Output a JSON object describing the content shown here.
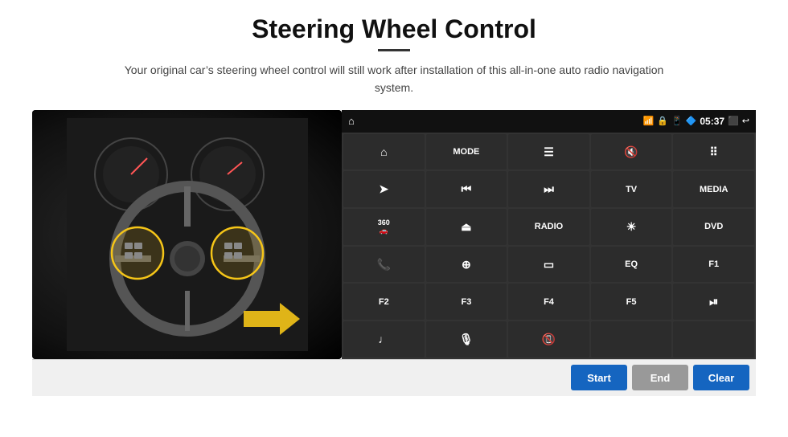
{
  "page": {
    "title": "Steering Wheel Control",
    "subtitle": "Your original car’s steering wheel control will still work after installation of this all-in-one auto radio navigation system.",
    "divider_color": "#333"
  },
  "status_bar": {
    "time": "05:37",
    "icons": [
      "wifi",
      "lock",
      "sim",
      "bluetooth",
      "cast",
      "back"
    ]
  },
  "grid_buttons": [
    {
      "id": "home",
      "icon": "⌂",
      "label": ""
    },
    {
      "id": "mode",
      "icon": "",
      "label": "MODE"
    },
    {
      "id": "list",
      "icon": "☰",
      "label": ""
    },
    {
      "id": "mute",
      "icon": "🔇",
      "label": ""
    },
    {
      "id": "apps",
      "icon": "…",
      "label": ""
    },
    {
      "id": "nav",
      "icon": "➤",
      "label": ""
    },
    {
      "id": "prev",
      "icon": "⏮",
      "label": ""
    },
    {
      "id": "next",
      "icon": "⏭",
      "label": ""
    },
    {
      "id": "tv",
      "icon": "",
      "label": "TV"
    },
    {
      "id": "media",
      "icon": "",
      "label": "MEDIA"
    },
    {
      "id": "cam360",
      "icon": "📷",
      "label": "360"
    },
    {
      "id": "eject",
      "icon": "⏏",
      "label": ""
    },
    {
      "id": "radio",
      "icon": "",
      "label": "RADIO"
    },
    {
      "id": "brightness",
      "icon": "☀",
      "label": ""
    },
    {
      "id": "dvd",
      "icon": "",
      "label": "DVD"
    },
    {
      "id": "phone",
      "icon": "📞",
      "label": ""
    },
    {
      "id": "nav2",
      "icon": "⌖",
      "label": ""
    },
    {
      "id": "screen",
      "icon": "☐",
      "label": ""
    },
    {
      "id": "eq",
      "icon": "",
      "label": "EQ"
    },
    {
      "id": "f1",
      "icon": "",
      "label": "F1"
    },
    {
      "id": "f2",
      "icon": "",
      "label": "F2"
    },
    {
      "id": "f3",
      "icon": "",
      "label": "F3"
    },
    {
      "id": "f4",
      "icon": "",
      "label": "F4"
    },
    {
      "id": "f5",
      "icon": "",
      "label": "F5"
    },
    {
      "id": "playpause",
      "icon": "⏯",
      "label": ""
    },
    {
      "id": "music",
      "icon": "♫",
      "label": ""
    },
    {
      "id": "mic",
      "icon": "🎤",
      "label": ""
    },
    {
      "id": "callend",
      "icon": "📵",
      "label": ""
    },
    {
      "id": "empty1",
      "icon": "",
      "label": ""
    },
    {
      "id": "empty2",
      "icon": "",
      "label": ""
    }
  ],
  "bottom_bar": {
    "start_label": "Start",
    "end_label": "End",
    "clear_label": "Clear",
    "start_color": "#1565c0",
    "end_color": "#999999",
    "clear_color": "#1565c0"
  }
}
